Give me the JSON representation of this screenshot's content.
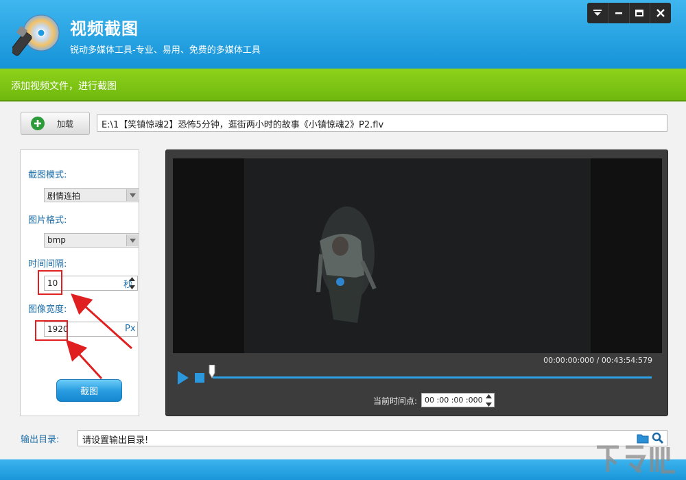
{
  "header": {
    "title": "视频截图",
    "subtitle": "锐动多媒体工具-专业、易用、免费的多媒体工具"
  },
  "window_controls": {
    "menu": "menu-icon",
    "minimize": "minimize-icon",
    "maximize": "maximize-icon",
    "close": "close-icon"
  },
  "greenbar": {
    "text": "添加视频文件，进行截图"
  },
  "load": {
    "button_label": "加载",
    "file_path": "E:\\1【笑镇惊魂2】恐怖5分钟，逛街两小时的故事《小镇惊魂2》P2.flv"
  },
  "settings": {
    "mode_label": "截图模式:",
    "mode_value": "剧情连拍",
    "format_label": "图片格式:",
    "format_value": "bmp",
    "interval_label": "时间间隔:",
    "interval_value": "10",
    "interval_unit": "秒",
    "width_label": "图像宽度:",
    "width_value": "1920",
    "width_unit": "Px",
    "capture_button": "截图"
  },
  "player": {
    "time_readout": "00:00:00:000 / 00:43:54:579",
    "progress": 0.0,
    "current_time_label": "当前时间点:",
    "current_time_value": "00 :00 :00 :000"
  },
  "output": {
    "label": "输出目录:",
    "value": "请设置输出目录!"
  },
  "colors": {
    "header_blue": "#1e9be0",
    "green_bar": "#7cc414",
    "accent_blue": "#2b97dc",
    "highlight_red": "#e02020"
  }
}
